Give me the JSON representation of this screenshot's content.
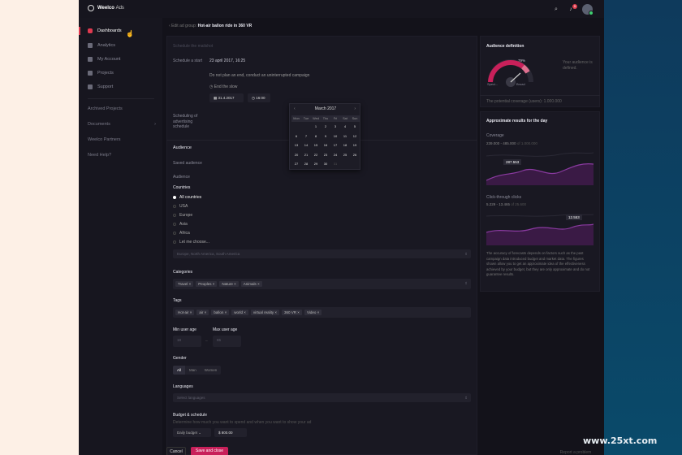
{
  "app": {
    "brand": "Weelco",
    "brand_suffix": "Ads",
    "notification_count": "5"
  },
  "sidebar": {
    "items": [
      {
        "label": "Dashboards",
        "active": true
      },
      {
        "label": "Analytics"
      },
      {
        "label": "My Account"
      },
      {
        "label": "Projects"
      },
      {
        "label": "Support"
      }
    ],
    "archived": "Archived Projects",
    "documents": "Documents",
    "partners": "Weelco Partners",
    "help": "Need Help?"
  },
  "breadcrumb": {
    "back": "Edit ad group:",
    "title": "Hot-air ballon ride in 360 VR"
  },
  "schedule": {
    "placeholder_title": "Schedule the mailshot",
    "start_label": "Schedule a start",
    "start_value": "23 april 2017, 16:25",
    "no_end": "Do not plan an end, conduct an uninterrupted campaign",
    "end_slow": "End the slow",
    "end_date": "31.4.2017",
    "end_time": "16:00",
    "scheduling_label": "Scheduling of advertising schedule"
  },
  "calendar": {
    "month": "March 2017",
    "dows": [
      "Mon",
      "Tue",
      "Wed",
      "Thu",
      "Fri",
      "Sat",
      "Sun"
    ],
    "days": [
      "",
      "",
      "1",
      "2",
      "3",
      "4",
      "5",
      "6",
      "7",
      "8",
      "9",
      "10",
      "11",
      "12",
      "13",
      "14",
      "15",
      "16",
      "17",
      "18",
      "19",
      "20",
      "21",
      "22",
      "23",
      "24",
      "25",
      "26",
      "27",
      "28",
      "29",
      "30",
      "31",
      "",
      ""
    ]
  },
  "audience": {
    "section": "Audience",
    "saved_label": "Saved audience",
    "audience_label": "Audience",
    "countries_label": "Countries",
    "countries": [
      "All countries",
      "USA",
      "Europe",
      "Asia",
      "Africa",
      "Let me choose..."
    ],
    "countries_placeholder": "Europe, North America, South America",
    "categories_label": "Categories",
    "categories": [
      "Travel",
      "Peoples",
      "Nature",
      "Animals"
    ],
    "tags_label": "Tags",
    "tags": [
      "Hot-air",
      "air",
      "ballon",
      "world",
      "virtual reality",
      "360 VR",
      "Video"
    ],
    "min_age_label": "Min user age",
    "max_age_label": "Max user age",
    "min_age": "18",
    "max_age": "65",
    "gender_label": "Gender",
    "gender_options": [
      "All",
      "Man",
      "Women"
    ],
    "languages_label": "Languages",
    "languages_placeholder": "Select languages",
    "budget_label": "Budget & schedule",
    "budget_hint": "Determine how much you want to spend and when you want to show your ad",
    "budget_type": "Daily budget",
    "budget_amount": "$ 800.00"
  },
  "actions": {
    "cancel": "Cancel",
    "save": "Save and close",
    "report": "Report a problem"
  },
  "definition": {
    "title": "Audience definition",
    "percent": "79%",
    "spec": "Speci...",
    "broad": "Broad",
    "note": "Your audience is defined.",
    "coverage": "The potential coverage (users): 1.000.000"
  },
  "results": {
    "title": "Approximate results for the day",
    "coverage_label": "Coverage",
    "coverage_range": "239.000 - 485.000",
    "coverage_of": "of 1.000.000",
    "coverage_point": "287.553",
    "ctr_label": "Click-through clicks",
    "ctr_range": "5.229 - 13.465",
    "ctr_of": "of 25.600",
    "ctr_point": "12.553",
    "note": "The accuracy of forecasts depends on factors such as the past campaign data introduced budget and market data. The figures shown allow you to get an approximate idea of the effectiveness achieved by your budget, but they are only approximate and do not guarantee results."
  },
  "watermark": "www.25xt.com",
  "colors": {
    "accent": "#e03a50",
    "purple": "#7a2a8a",
    "bg": "#13121a"
  }
}
